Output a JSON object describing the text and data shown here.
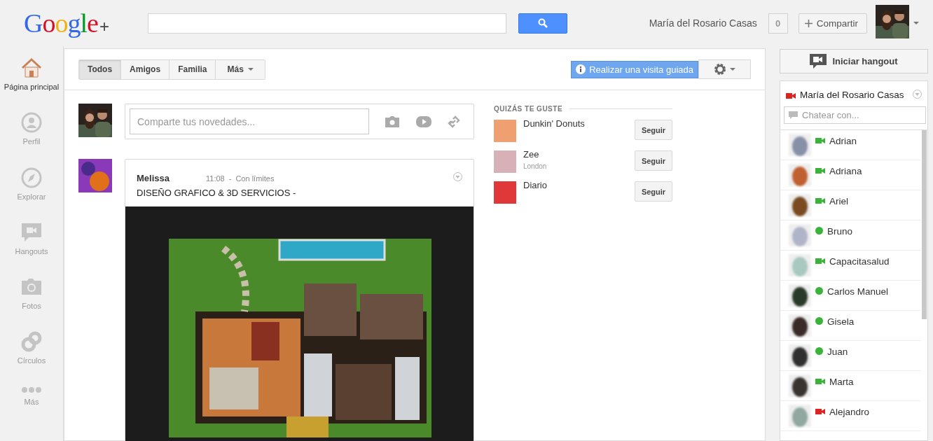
{
  "header": {
    "logo": "Google",
    "logo_plus": "+",
    "user_name": "María del Rosario Casas",
    "notifications": "0",
    "share": "Compartir"
  },
  "sidebar": {
    "items": [
      {
        "label": "Página principal",
        "selected": true
      },
      {
        "label": "Perfil",
        "selected": false
      },
      {
        "label": "Explorar",
        "selected": false
      },
      {
        "label": "Hangouts",
        "selected": false
      },
      {
        "label": "Fotos",
        "selected": false
      },
      {
        "label": "Círculos",
        "selected": false
      },
      {
        "label": "Más",
        "selected": false
      }
    ]
  },
  "stream": {
    "filters": [
      {
        "label": "Todos",
        "selected": true,
        "dropdown": false
      },
      {
        "label": "Amigos",
        "selected": false,
        "dropdown": false
      },
      {
        "label": "Familia",
        "selected": false,
        "dropdown": false
      },
      {
        "label": "Más",
        "selected": false,
        "dropdown": true
      }
    ],
    "tour": "Realizar una visita guiada",
    "share_box": {
      "placeholder": "Comparte tus novedades..."
    },
    "post": {
      "author": "Melissa",
      "time": "11:08",
      "separator": "-",
      "visibility": "Con límites",
      "text": "DISEÑO GRAFICO & 3D SERVICIOS -"
    }
  },
  "suggestions": {
    "title": "QUIZÁS TE GUSTE",
    "items": [
      {
        "name": "Dunkin' Donuts",
        "color": "#f0a070",
        "button": "Seguir"
      },
      {
        "name": "Zee",
        "subtitle": "London",
        "color": "#d8b0b8",
        "button": "Seguir"
      },
      {
        "name": "Diario",
        "color": "#e03838",
        "button": "Seguir"
      }
    ]
  },
  "chat": {
    "hangout_button": "Iniciar hangout",
    "self": {
      "name": "María del Rosario Casas",
      "kind": "video",
      "color": "#dd2222"
    },
    "search": {
      "placeholder": "Chatear con..."
    },
    "contacts": [
      {
        "name": "Adrian",
        "kind": "video",
        "color": "#3bb33b"
      },
      {
        "name": "Adriana",
        "kind": "video",
        "color": "#3bb33b"
      },
      {
        "name": "Ariel",
        "kind": "video",
        "color": "#3bb33b"
      },
      {
        "name": "Bruno",
        "kind": "dot",
        "color": "#3bb33b"
      },
      {
        "name": "Capacitasalud",
        "kind": "video",
        "color": "#3bb33b"
      },
      {
        "name": "Carlos Manuel",
        "kind": "dot",
        "color": "#3bb33b"
      },
      {
        "name": "Gisela",
        "kind": "dot",
        "color": "#3bb33b"
      },
      {
        "name": "Juan",
        "kind": "dot",
        "color": "#3bb33b"
      },
      {
        "name": "Marta",
        "kind": "video",
        "color": "#3bb33b"
      },
      {
        "name": "Alejandro",
        "kind": "video",
        "color": "#dd2222"
      }
    ]
  }
}
